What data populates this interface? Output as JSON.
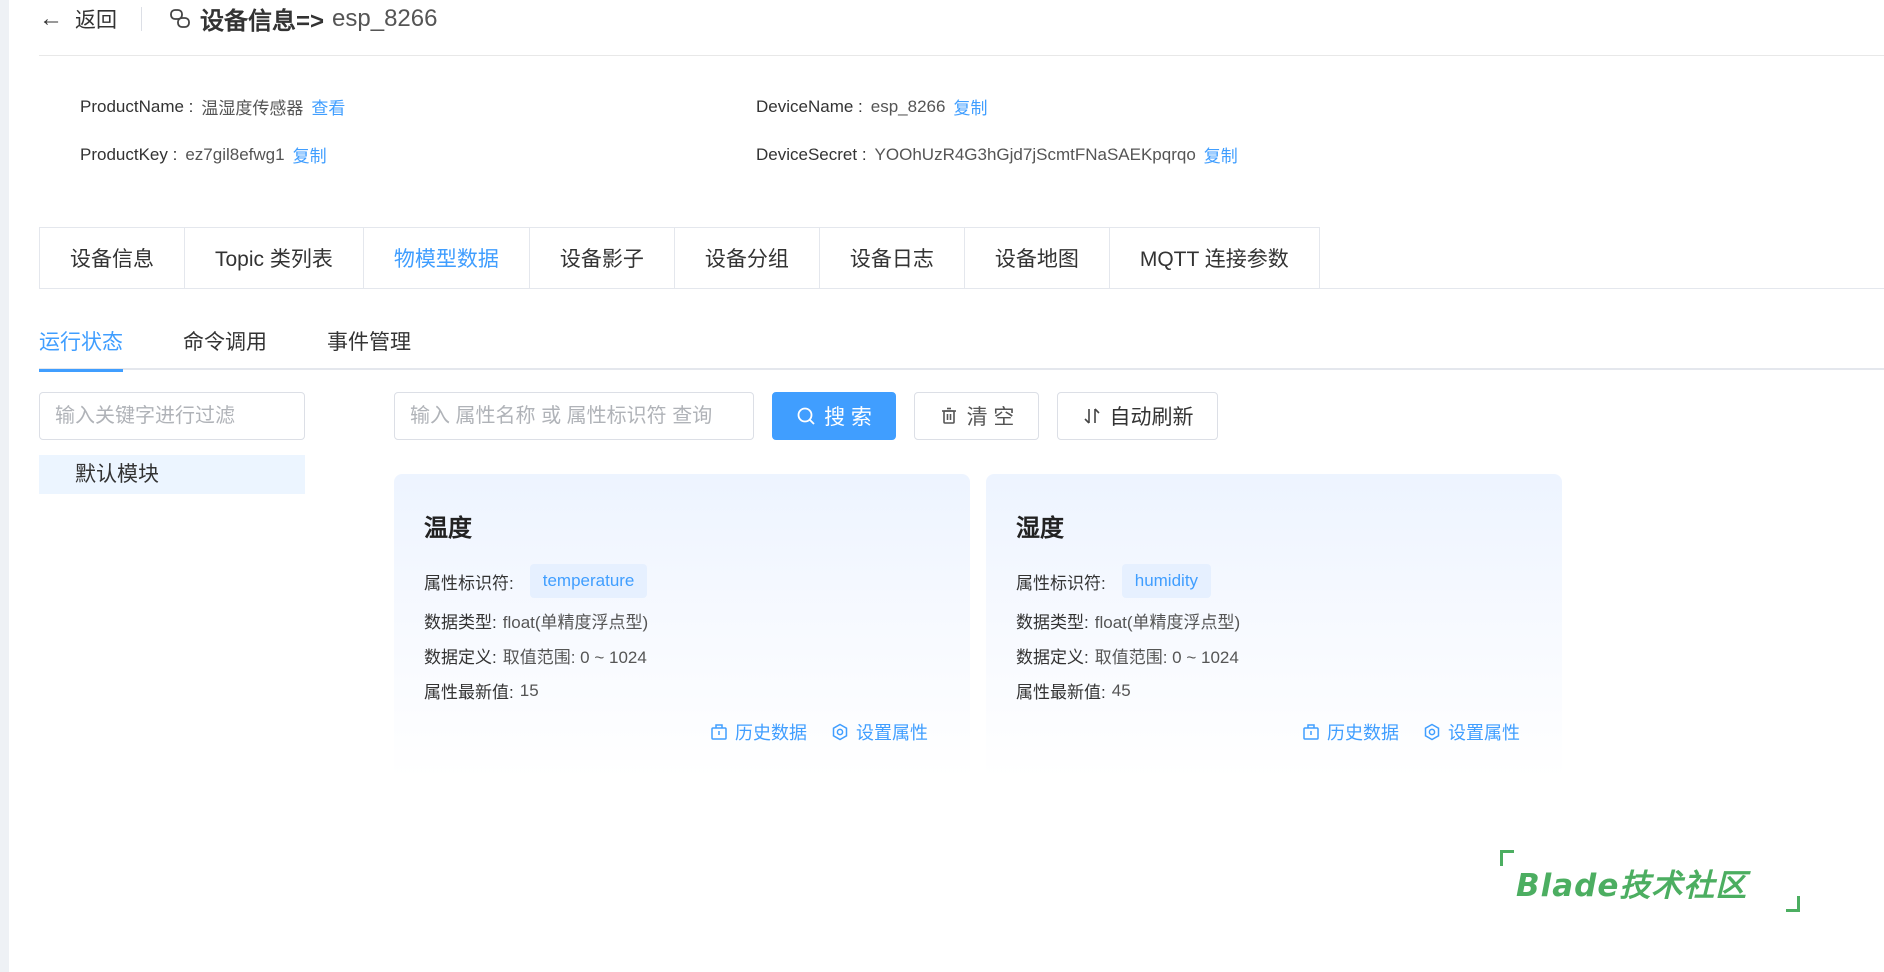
{
  "header": {
    "back_label": "返回",
    "title_main": "设备信息=>",
    "title_device": "esp_8266"
  },
  "info": {
    "product_name_label": "ProductName :",
    "product_name_value": "温湿度传感器",
    "product_name_link": "查看",
    "product_key_label": "ProductKey :",
    "product_key_value": "ez7gil8efwg1",
    "product_key_link": "复制",
    "device_name_label": "DeviceName :",
    "device_name_value": "esp_8266",
    "device_name_link": "复制",
    "device_secret_label": "DeviceSecret :",
    "device_secret_value": "YOOhUzR4G3hGjd7jScmtFNaSAEKpqrqo",
    "device_secret_link": "复制"
  },
  "main_tabs": [
    {
      "label": "设备信息",
      "active": false
    },
    {
      "label": "Topic 类列表",
      "active": false
    },
    {
      "label": "物模型数据",
      "active": true
    },
    {
      "label": "设备影子",
      "active": false
    },
    {
      "label": "设备分组",
      "active": false
    },
    {
      "label": "设备日志",
      "active": false
    },
    {
      "label": "设备地图",
      "active": false
    },
    {
      "label": "MQTT 连接参数",
      "active": false
    }
  ],
  "sub_tabs": [
    {
      "label": "运行状态",
      "active": true
    },
    {
      "label": "命令调用",
      "active": false
    },
    {
      "label": "事件管理",
      "active": false
    }
  ],
  "sidebar": {
    "filter_placeholder": "输入关键字进行过滤",
    "tree_node": "默认模块"
  },
  "toolbar": {
    "search_placeholder": "输入 属性名称 或 属性标识符 查询",
    "search_label": "搜 索",
    "clear_label": "清 空",
    "refresh_label": "自动刷新"
  },
  "cards": [
    {
      "title": "温度",
      "identifier_label": "属性标识符:",
      "identifier": "temperature",
      "type_label": "数据类型:",
      "type": "float(单精度浮点型)",
      "def_label": "数据定义:",
      "definition": "取值范围: 0 ~ 1024",
      "latest_label": "属性最新值:",
      "latest": "15",
      "history_label": "历史数据",
      "set_label": "设置属性"
    },
    {
      "title": "湿度",
      "identifier_label": "属性标识符:",
      "identifier": "humidity",
      "type_label": "数据类型:",
      "type": "float(单精度浮点型)",
      "def_label": "数据定义:",
      "definition": "取值范围: 0 ~ 1024",
      "latest_label": "属性最新值:",
      "latest": "45",
      "history_label": "历史数据",
      "set_label": "设置属性"
    }
  ],
  "watermark": {
    "text": "Blade技术社区"
  },
  "colors": {
    "accent": "#409eff",
    "watermark": "#4cae61"
  }
}
